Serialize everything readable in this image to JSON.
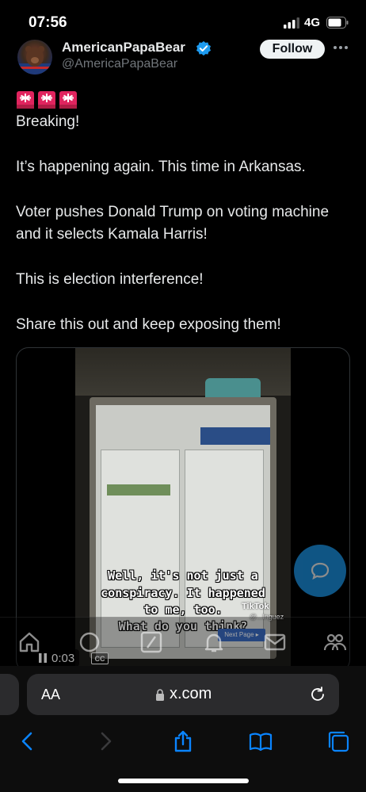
{
  "status_bar": {
    "time": "07:56",
    "network": "4G"
  },
  "post": {
    "author": {
      "display_name": "AmericanPapaBear",
      "handle": "@AmericaPapaBear",
      "verified": true
    },
    "follow_label": "Follow",
    "lines": [
      "Breaking!",
      "It’s happening again. This time in Arkansas.",
      "Voter pushes Donald Trump on voting machine and it selects Kamala Harris!",
      "This is election interference!",
      "Share this out and keep exposing them!"
    ]
  },
  "video": {
    "captions": [
      "Well, it's not just a",
      "conspiracy. It happened",
      "to me, too.",
      "What do you think?"
    ],
    "watermark": "TikTok",
    "watermark_user": "@...lnguez",
    "next_page": "Next Page ▸",
    "timestamp": "0:03",
    "cc_label": "CC"
  },
  "browser": {
    "aa_label": "AA",
    "url": "x.com"
  },
  "colors": {
    "accent": "#1d9bf0",
    "text": "#e7e9ea",
    "muted": "#71767b"
  },
  "icons": [
    "signal-icon",
    "battery-icon",
    "verified-icon",
    "more-icon",
    "siren-icon",
    "pause-icon",
    "compose-icon",
    "home-icon",
    "grok-icon",
    "compose-post-icon",
    "notifications-icon",
    "messages-icon",
    "communities-icon",
    "lock-icon",
    "reload-icon",
    "back-icon",
    "forward-icon",
    "share-icon",
    "bookmarks-icon",
    "tabs-icon"
  ]
}
